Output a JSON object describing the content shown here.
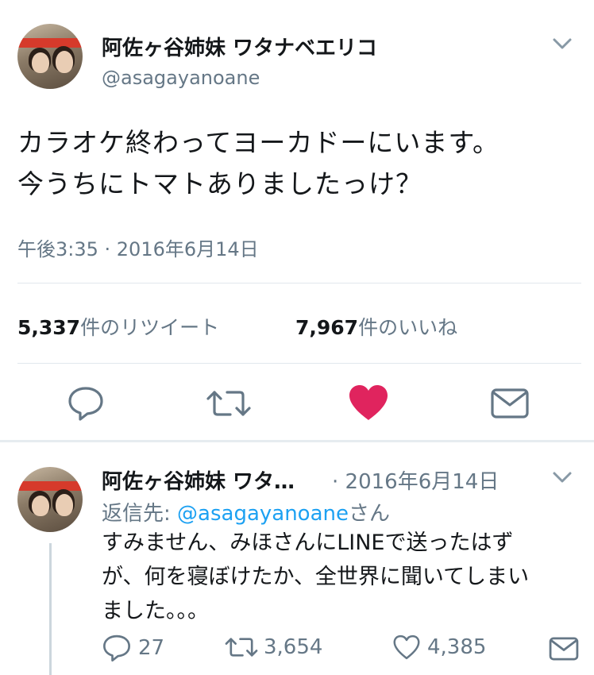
{
  "main_tweet": {
    "display_name": "阿佐ヶ谷姉妹 ワタナベエリコ",
    "handle": "@asagayanoane",
    "text_line1": "カラオケ終わってヨーカドーにいます。",
    "text_line2": "今うちにトマトありましたっけ？",
    "timestamp": "午後3:35 · 2016年6月14日",
    "retweet_count": "5,337",
    "retweet_label": "件のリツイート",
    "like_count": "7,967",
    "like_label": "件のいいね",
    "liked": true
  },
  "reply": {
    "display_name": "阿佐ヶ谷姉妹 ワタ…",
    "date": "· 2016年6月14日",
    "reply_to_prefix": "返信先: ",
    "reply_to_handle": "@asagayanoane",
    "reply_to_suffix": "さん",
    "text_line1": "すみません、みほさんにLINEで送ったはず",
    "text_line2": "が、何を寝ぼけたか、全世界に聞いてしまい",
    "text_line3": "ました。。。",
    "reply_count": "27",
    "retweet_count": "3,654",
    "like_count": "4,385"
  },
  "colors": {
    "like_active": "#e0245e",
    "link": "#1da1f2",
    "secondary_text": "#657786",
    "icon_gray": "#657786"
  },
  "icons": [
    "chevron-down-icon",
    "reply-icon",
    "retweet-icon",
    "heart-icon",
    "share-icon"
  ]
}
